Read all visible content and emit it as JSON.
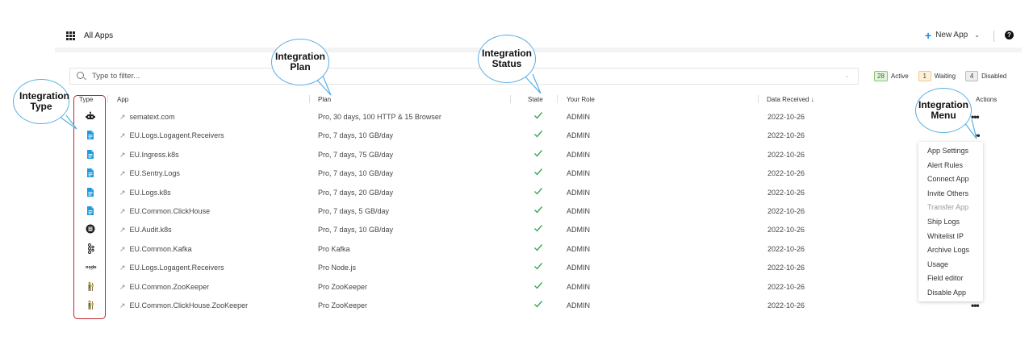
{
  "header": {
    "all_apps_label": "All Apps",
    "new_app_label": "New App",
    "help_label": "?"
  },
  "filter": {
    "placeholder": "Type to filter..."
  },
  "status_counts": {
    "active_count": "28",
    "active_label": "Active",
    "waiting_count": "1",
    "waiting_label": "Waiting",
    "disabled_count": "4",
    "disabled_label": "Disabled"
  },
  "columns": {
    "type": "Type",
    "app": "App",
    "plan": "Plan",
    "state": "State",
    "role": "Your Role",
    "date": "Data Received ↓",
    "actions": "Actions"
  },
  "rows": [
    {
      "type_icon": "robot-icon",
      "app": "sematext.com",
      "plan": "Pro, 30 days, 100 HTTP & 15 Browser",
      "state": "active",
      "role": "ADMIN",
      "date": "2022-10-26"
    },
    {
      "type_icon": "logs-document-icon",
      "app": "EU.Logs.Logagent.Receivers",
      "plan": "Pro, 7 days, 10 GB/day",
      "state": "active",
      "role": "ADMIN",
      "date": "2022-10-26"
    },
    {
      "type_icon": "logs-document-icon",
      "app": "EU.Ingress.k8s",
      "plan": "Pro, 7 days, 75 GB/day",
      "state": "active",
      "role": "ADMIN",
      "date": "2022-10-26"
    },
    {
      "type_icon": "logs-document-icon",
      "app": "EU.Sentry.Logs",
      "plan": "Pro, 7 days, 10 GB/day",
      "state": "active",
      "role": "ADMIN",
      "date": "2022-10-26"
    },
    {
      "type_icon": "logs-document-icon",
      "app": "EU.Logs.k8s",
      "plan": "Pro, 7 days, 20 GB/day",
      "state": "active",
      "role": "ADMIN",
      "date": "2022-10-26"
    },
    {
      "type_icon": "logs-document-icon",
      "app": "EU.Common.ClickHouse",
      "plan": "Pro, 7 days, 5 GB/day",
      "state": "active",
      "role": "ADMIN",
      "date": "2022-10-26"
    },
    {
      "type_icon": "audit-icon",
      "app": "EU.Audit.k8s",
      "plan": "Pro, 7 days, 10 GB/day",
      "state": "active",
      "role": "ADMIN",
      "date": "2022-10-26"
    },
    {
      "type_icon": "kafka-icon",
      "app": "EU.Common.Kafka",
      "plan": "Pro Kafka",
      "state": "active",
      "role": "ADMIN",
      "date": "2022-10-26"
    },
    {
      "type_icon": "nodejs-icon",
      "app": "EU.Logs.Logagent.Receivers",
      "plan": "Pro Node.js",
      "state": "active",
      "role": "ADMIN",
      "date": "2022-10-26"
    },
    {
      "type_icon": "zookeeper-icon",
      "app": "EU.Common.ZooKeeper",
      "plan": "Pro ZooKeeper",
      "state": "active",
      "role": "ADMIN",
      "date": "2022-10-26"
    },
    {
      "type_icon": "zookeeper-icon",
      "app": "EU.Common.ClickHouse.ZooKeeper",
      "plan": "Pro ZooKeeper",
      "state": "active",
      "role": "ADMIN",
      "date": "2022-10-26"
    }
  ],
  "nodejs_icon_text": "node",
  "actions_menu": {
    "items": [
      {
        "label": "App Settings",
        "muted": false
      },
      {
        "label": "Alert Rules",
        "muted": false
      },
      {
        "label": "Connect App",
        "muted": false
      },
      {
        "label": "Invite Others",
        "muted": false
      },
      {
        "label": "Transfer App",
        "muted": true
      },
      {
        "label": "Ship Logs",
        "muted": false
      },
      {
        "label": "Whitelist IP",
        "muted": false
      },
      {
        "label": "Archive Logs",
        "muted": false
      },
      {
        "label": "Usage",
        "muted": false
      },
      {
        "label": "Field editor",
        "muted": false
      },
      {
        "label": "Disable App",
        "muted": false
      }
    ]
  },
  "annotations": {
    "integration_type": "Integration Type",
    "integration_plan": "Integration Plan",
    "integration_status": "Integration Status",
    "integration_menu": "Integration Menu"
  },
  "colors": {
    "accent_blue": "#1e88e5",
    "check_green": "#3aa757",
    "frame_red": "#c0262c",
    "bubble_blue": "#5aaee0"
  }
}
